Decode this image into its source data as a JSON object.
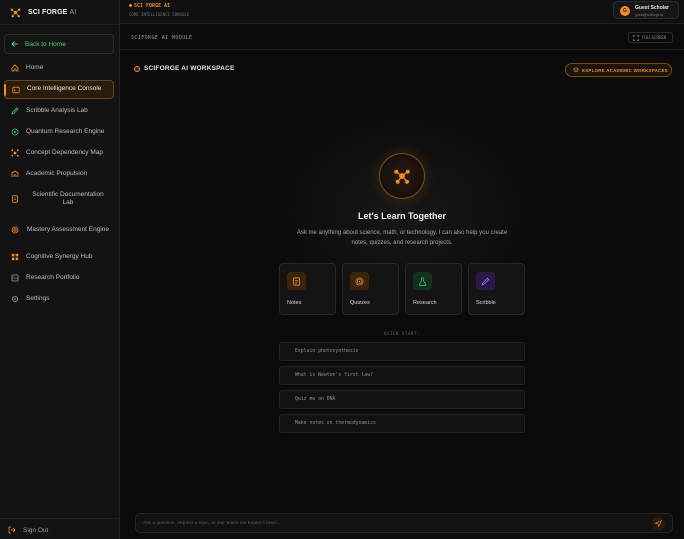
{
  "app": {
    "brand_main": "SCI FORGE",
    "brand_suffix": "AI"
  },
  "topbar": {
    "title": "SCI FORGE AI",
    "subtitle": "CORE INTELLIGENCE CONSOLE",
    "user": {
      "initial": "G",
      "name": "Guest Scholar",
      "email": "guest@sciforge.ai"
    }
  },
  "sidebar": {
    "back_label": "Back to Home",
    "items": [
      {
        "label": "Home",
        "icon": "home-icon"
      },
      {
        "label": "Core Intelligence Console",
        "icon": "console-icon",
        "active": true
      },
      {
        "label": "Scribble Analysis Lab",
        "icon": "scribble-icon"
      },
      {
        "label": "Quantum Research Engine",
        "icon": "quantum-icon"
      },
      {
        "label": "Concept Dependency Map",
        "icon": "map-icon"
      },
      {
        "label": "Academic Propulsion",
        "icon": "propulsion-icon"
      },
      {
        "label": "Scientific Documentation Lab",
        "icon": "documentation-icon"
      },
      {
        "label": "Mastery Assessment Engine",
        "icon": "assessment-icon"
      },
      {
        "label": "Cognitive Synergy Hub",
        "icon": "synergy-icon"
      },
      {
        "label": "Research Portfolio",
        "icon": "portfolio-icon"
      },
      {
        "label": "Settings",
        "icon": "gear-icon"
      }
    ],
    "signout_label": "Sign Out"
  },
  "module": {
    "title": "SCIFORGE AI MODULE",
    "fullscreen_label": "FULLSCREEN"
  },
  "workspace": {
    "title": "SCIFORGE AI WORKSPACE",
    "explore_label": "EXPLORE ACADEMIC WORKSPACES",
    "hero_title": "Let's Learn Together",
    "hero_desc": "Ask me anything about science, math, or technology. I can also help you create notes, quizzes, and research projects.",
    "cards": [
      {
        "label": "Notes",
        "icon": "notes-icon",
        "color": "#f28c28"
      },
      {
        "label": "Quizzes",
        "icon": "target-icon",
        "color": "#f28c28"
      },
      {
        "label": "Research",
        "icon": "flask-icon",
        "color": "#3ecf6e"
      },
      {
        "label": "Scribble",
        "icon": "pencil-icon",
        "color": "#a06bff"
      }
    ],
    "quick_start_label": "QUICK START:",
    "quick_start": [
      "Explain photosynthesis",
      "What is Newton's first law?",
      "Quiz me on DNA",
      "Make notes on thermodynamics"
    ]
  },
  "chat": {
    "placeholder": "Ask a question, request a topic, or say 'teach me Kepler's laws'..."
  },
  "colors": {
    "accent": "#f28c28",
    "success": "#4fd17e",
    "background": "#0b0b0b"
  }
}
